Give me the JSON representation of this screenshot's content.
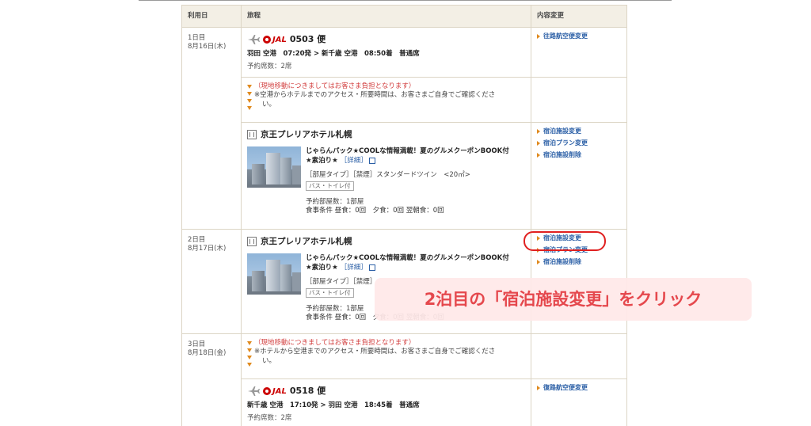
{
  "headers": {
    "date": "利用日",
    "itinerary": "旅程",
    "change": "内容変更"
  },
  "day1": {
    "label": "1日目",
    "date": "8月16日(木)",
    "flight": {
      "airline": "JAL",
      "number": "0503 便",
      "route": "羽田 空港　07:20発 > 新千歳 空港　08:50着　普通席",
      "seats": "予約席数：2席",
      "link": "往路航空便変更"
    },
    "notice": {
      "line1": "（現地移動につきましてはお客さま負担となります）",
      "line2": "※空港からホテルまでのアクセス・所要時間は、お客さまご自身でご確認くださ",
      "line3": "い。"
    },
    "hotel": {
      "name": "京王プレリアホテル札幌",
      "plan1": "じゃらんパック★COOLな情報満載！夏のグルメクーポンBOOK付",
      "plan2": "★素泊り★",
      "detail": "［詳細］",
      "room": "［部屋タイプ］［禁煙］スタンダードツイン　<20㎡>",
      "badge": "バス・トイレ付",
      "rooms": "予約部屋数：1部屋",
      "meals": "食事条件 昼食：0回　夕食：0回 翌朝食：0回",
      "links": [
        "宿泊施設変更",
        "宿泊プラン変更",
        "宿泊施設削除"
      ]
    }
  },
  "day2": {
    "label": "2日目",
    "date": "8月17日(木)",
    "hotel": {
      "name": "京王プレリアホテル札幌",
      "plan1": "じゃらんパック★COOLな情報満載！夏のグルメクーポンBOOK付",
      "plan2": "★素泊り★",
      "detail": "［詳細］",
      "room": "［部屋タイプ］［禁煙］",
      "badge": "バス・トイレ付",
      "rooms": "予約部屋数：1部屋",
      "meals": "食事条件 昼食：0回　夕食：0回 翌朝食：0回",
      "links": [
        "宿泊施設変更",
        "宿泊プラン変更",
        "宿泊施設削除"
      ]
    }
  },
  "day3": {
    "label": "3日目",
    "date": "8月18日(金)",
    "notice": {
      "line1": "（現地移動につきましてはお客さま負担となります）",
      "line2": "※ホテルから空港までのアクセス・所要時間は、お客さまご自身でご確認くださ",
      "line3": "い。"
    },
    "flight": {
      "airline": "JAL",
      "number": "0518 便",
      "route": "新千歳 空港　17:10発 > 羽田 空港　18:45着　普通席",
      "seats": "予約席数：2席",
      "link": "復路航空便変更"
    }
  },
  "callout": "2泊目の「宿泊施設変更」をクリック",
  "colors": {
    "link": "#2b5fa6",
    "accent": "#e08a1e",
    "callout_text": "#e5484d",
    "ring": "#e02020"
  }
}
